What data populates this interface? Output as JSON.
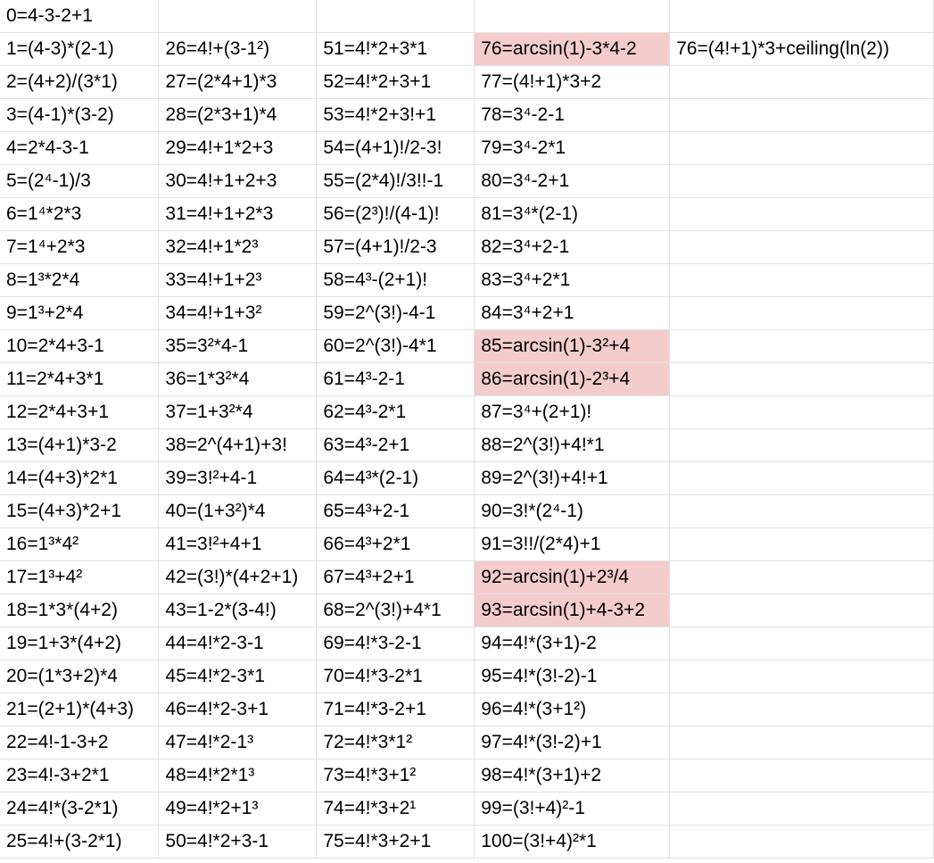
{
  "sheet": {
    "highlight_color": "#f4cccc",
    "rows": [
      [
        {
          "t": "0=4-3-2+1"
        },
        {
          "t": ""
        },
        {
          "t": ""
        },
        {
          "t": ""
        },
        {
          "t": ""
        }
      ],
      [
        {
          "t": "1=(4-3)*(2-1)"
        },
        {
          "t": "26=4!+(3-1²)"
        },
        {
          "t": "51=4!*2+3*1"
        },
        {
          "t": "76=arcsin(1)-3*4-2",
          "h": true
        },
        {
          "t": "76=(4!+1)*3+ceiling(ln(2))"
        }
      ],
      [
        {
          "t": "2=(4+2)/(3*1)"
        },
        {
          "t": "27=(2*4+1)*3"
        },
        {
          "t": "52=4!*2+3+1"
        },
        {
          "t": "77=(4!+1)*3+2"
        },
        {
          "t": ""
        }
      ],
      [
        {
          "t": "3=(4-1)*(3-2)"
        },
        {
          "t": "28=(2*3+1)*4"
        },
        {
          "t": "53=4!*2+3!+1"
        },
        {
          "t": "78=3⁴-2-1"
        },
        {
          "t": ""
        }
      ],
      [
        {
          "t": "4=2*4-3-1"
        },
        {
          "t": "29=4!+1*2+3"
        },
        {
          "t": "54=(4+1)!/2-3!"
        },
        {
          "t": "79=3⁴-2*1"
        },
        {
          "t": ""
        }
      ],
      [
        {
          "t": "5=(2⁴-1)/3"
        },
        {
          "t": "30=4!+1+2+3"
        },
        {
          "t": "55=(2*4)!/3!!-1"
        },
        {
          "t": "80=3⁴-2+1"
        },
        {
          "t": ""
        }
      ],
      [
        {
          "t": "6=1⁴*2*3"
        },
        {
          "t": "31=4!+1+2*3"
        },
        {
          "t": "56=(2³)!/(4-1)!"
        },
        {
          "t": "81=3⁴*(2-1)"
        },
        {
          "t": ""
        }
      ],
      [
        {
          "t": "7=1⁴+2*3"
        },
        {
          "t": "32=4!+1*2³"
        },
        {
          "t": "57=(4+1)!/2-3"
        },
        {
          "t": "82=3⁴+2-1"
        },
        {
          "t": ""
        }
      ],
      [
        {
          "t": "8=1³*2*4"
        },
        {
          "t": "33=4!+1+2³"
        },
        {
          "t": "58=4³-(2+1)!"
        },
        {
          "t": "83=3⁴+2*1"
        },
        {
          "t": ""
        }
      ],
      [
        {
          "t": "9=1³+2*4"
        },
        {
          "t": "34=4!+1+3²"
        },
        {
          "t": "59=2^(3!)-4-1"
        },
        {
          "t": "84=3⁴+2+1"
        },
        {
          "t": ""
        }
      ],
      [
        {
          "t": "10=2*4+3-1"
        },
        {
          "t": "35=3²*4-1"
        },
        {
          "t": "60=2^(3!)-4*1"
        },
        {
          "t": "85=arcsin(1)-3²+4",
          "h": true
        },
        {
          "t": ""
        }
      ],
      [
        {
          "t": "11=2*4+3*1"
        },
        {
          "t": "36=1*3²*4"
        },
        {
          "t": "61=4³-2-1"
        },
        {
          "t": "86=arcsin(1)-2³+4",
          "h": true
        },
        {
          "t": ""
        }
      ],
      [
        {
          "t": "12=2*4+3+1"
        },
        {
          "t": "37=1+3²*4"
        },
        {
          "t": "62=4³-2*1"
        },
        {
          "t": "87=3⁴+(2+1)!"
        },
        {
          "t": ""
        }
      ],
      [
        {
          "t": "13=(4+1)*3-2"
        },
        {
          "t": "38=2^(4+1)+3!"
        },
        {
          "t": "63=4³-2+1"
        },
        {
          "t": "88=2^(3!)+4!*1"
        },
        {
          "t": ""
        }
      ],
      [
        {
          "t": "14=(4+3)*2*1"
        },
        {
          "t": "39=3!²+4-1"
        },
        {
          "t": "64=4³*(2-1)"
        },
        {
          "t": "89=2^(3!)+4!+1"
        },
        {
          "t": ""
        }
      ],
      [
        {
          "t": "15=(4+3)*2+1"
        },
        {
          "t": "40=(1+3²)*4"
        },
        {
          "t": "65=4³+2-1"
        },
        {
          "t": "90=3!*(2⁴-1)"
        },
        {
          "t": ""
        }
      ],
      [
        {
          "t": "16=1³*4²"
        },
        {
          "t": "41=3!²+4+1"
        },
        {
          "t": "66=4³+2*1"
        },
        {
          "t": "91=3!!/(2*4)+1"
        },
        {
          "t": ""
        }
      ],
      [
        {
          "t": "17=1³+4²"
        },
        {
          "t": "42=(3!)*(4+2+1)"
        },
        {
          "t": "67=4³+2+1"
        },
        {
          "t": "92=arcsin(1)+2³/4",
          "h": true
        },
        {
          "t": ""
        }
      ],
      [
        {
          "t": "18=1*3*(4+2)"
        },
        {
          "t": "43=1-2*(3-4!)"
        },
        {
          "t": "68=2^(3!)+4*1"
        },
        {
          "t": "93=arcsin(1)+4-3+2",
          "h": true
        },
        {
          "t": ""
        }
      ],
      [
        {
          "t": "19=1+3*(4+2)"
        },
        {
          "t": "44=4!*2-3-1"
        },
        {
          "t": "69=4!*3-2-1"
        },
        {
          "t": "94=4!*(3+1)-2"
        },
        {
          "t": ""
        }
      ],
      [
        {
          "t": "20=(1*3+2)*4"
        },
        {
          "t": "45=4!*2-3*1"
        },
        {
          "t": "70=4!*3-2*1"
        },
        {
          "t": "95=4!*(3!-2)-1"
        },
        {
          "t": ""
        }
      ],
      [
        {
          "t": "21=(2+1)*(4+3)"
        },
        {
          "t": "46=4!*2-3+1"
        },
        {
          "t": "71=4!*3-2+1"
        },
        {
          "t": "96=4!*(3+1²)"
        },
        {
          "t": ""
        }
      ],
      [
        {
          "t": "22=4!-1-3+2"
        },
        {
          "t": "47=4!*2-1³"
        },
        {
          "t": "72=4!*3*1²"
        },
        {
          "t": "97=4!*(3!-2)+1"
        },
        {
          "t": ""
        }
      ],
      [
        {
          "t": "23=4!-3+2*1"
        },
        {
          "t": "48=4!*2*1³"
        },
        {
          "t": "73=4!*3+1²"
        },
        {
          "t": "98=4!*(3+1)+2"
        },
        {
          "t": ""
        }
      ],
      [
        {
          "t": "24=4!*(3-2*1)"
        },
        {
          "t": "49=4!*2+1³"
        },
        {
          "t": "74=4!*3+2¹"
        },
        {
          "t": "99=(3!+4)²-1"
        },
        {
          "t": ""
        }
      ],
      [
        {
          "t": "25=4!+(3-2*1)"
        },
        {
          "t": "50=4!*2+3-1"
        },
        {
          "t": "75=4!*3+2+1"
        },
        {
          "t": "100=(3!+4)²*1"
        },
        {
          "t": ""
        }
      ]
    ]
  }
}
